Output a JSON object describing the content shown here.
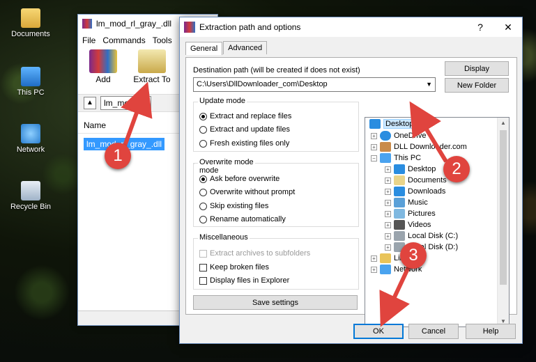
{
  "desktop": {
    "icons": [
      {
        "label": "Documents",
        "icon": "documents-icon"
      },
      {
        "label": "This PC",
        "icon": "computer-icon"
      },
      {
        "label": "Network",
        "icon": "network-icon"
      },
      {
        "label": "Recycle Bin",
        "icon": "recycle-bin-icon"
      }
    ]
  },
  "winrar": {
    "title": "lm_mod_rl_gray_.dll",
    "menu": [
      "File",
      "Commands",
      "Tools"
    ],
    "toolbar": [
      {
        "label": "Add",
        "icon": "add-archive-icon"
      },
      {
        "label": "Extract To",
        "icon": "extract-to-icon"
      }
    ],
    "path": "lm_mod_rl_",
    "list_header": "Name",
    "file": "lm_mod_rl_gray_.dll"
  },
  "dialog": {
    "title": "Extraction path and options",
    "help_btn": "?",
    "close_btn": "✕",
    "tabs": [
      "General",
      "Advanced"
    ],
    "destination_label": "Destination path (will be created if does not exist)",
    "destination_value": "C:\\Users\\DllDownloader_com\\Desktop",
    "display_btn": "Display",
    "new_folder_btn": "New Folder",
    "update_mode": {
      "title": "Update mode",
      "options": [
        "Extract and replace files",
        "Extract and update files",
        "Fresh existing files only"
      ],
      "selected": 0
    },
    "overwrite_mode": {
      "title": "Overwrite mode",
      "options": [
        "Ask before overwrite",
        "Overwrite without prompt",
        "Skip existing files",
        "Rename automatically"
      ],
      "selected": 0
    },
    "misc": {
      "title": "Miscellaneous",
      "options": [
        "Extract archives to subfolders",
        "Keep broken files",
        "Display files in Explorer"
      ]
    },
    "save_settings": "Save settings",
    "ok": "OK",
    "cancel": "Cancel",
    "help": "Help",
    "tree": [
      {
        "label": "Desktop",
        "selected": true
      },
      {
        "label": "OneDrive"
      },
      {
        "label": "DLL Downloader.com"
      },
      {
        "label": "This PC"
      },
      {
        "label": "Desktop"
      },
      {
        "label": "Documents"
      },
      {
        "label": "Downloads"
      },
      {
        "label": "Music"
      },
      {
        "label": "Pictures"
      },
      {
        "label": "Videos"
      },
      {
        "label": "Local Disk (C:)"
      },
      {
        "label": "Local Disk (D:)"
      },
      {
        "label": "Libraries"
      },
      {
        "label": "Network"
      }
    ]
  },
  "annotations": [
    "1",
    "2",
    "3"
  ],
  "colors": {
    "accent": "#0078d7",
    "badge": "#e0443e",
    "selection": "#3399ff"
  }
}
